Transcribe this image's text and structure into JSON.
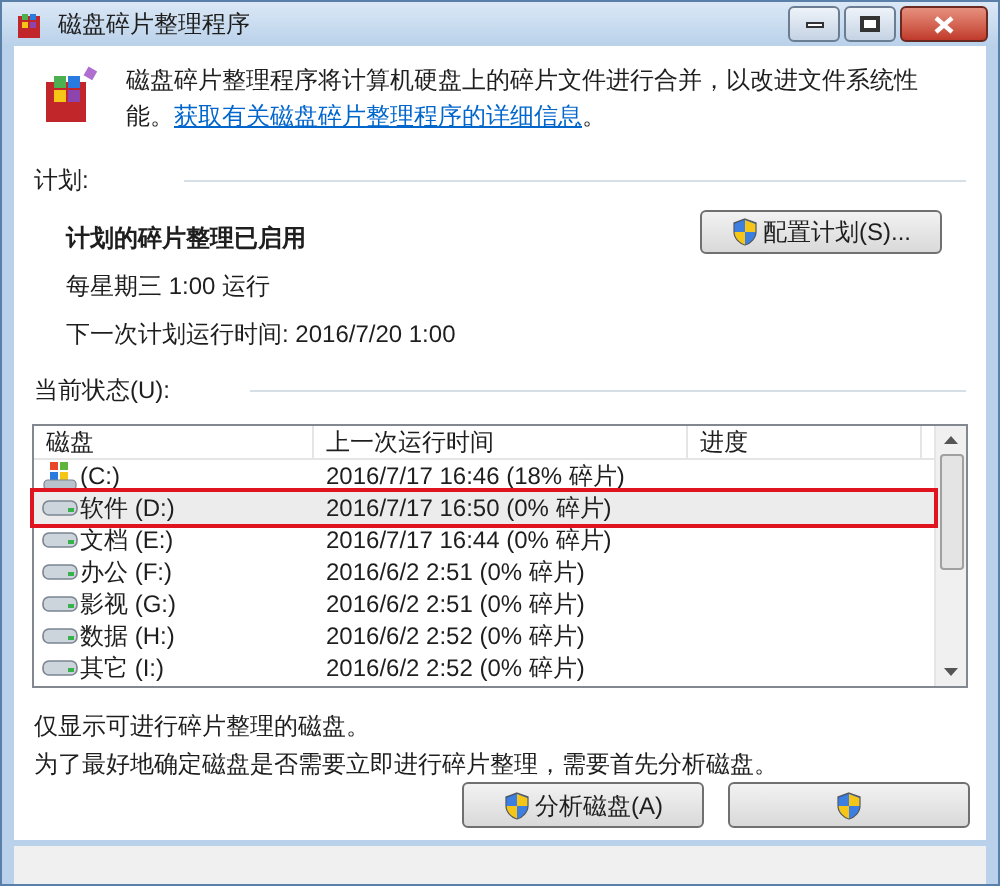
{
  "window": {
    "title": "磁盘碎片整理程序"
  },
  "intro": {
    "text": "磁盘碎片整理程序将计算机硬盘上的碎片文件进行合并，以改进文件系统性能。",
    "link": "获取有关磁盘碎片整理程序的详细信息",
    "tail": "。"
  },
  "schedule": {
    "label": "计划:",
    "status": "计划的碎片整理已启用",
    "frequency": "每星期三  1:00 运行",
    "next_run": "下一次计划运行时间: 2016/7/20 1:00",
    "button": "配置计划(S)..."
  },
  "current_status": {
    "label": "当前状态(U):",
    "columns": [
      "磁盘",
      "上一次运行时间",
      "进度"
    ],
    "rows": [
      {
        "kind": "system",
        "disk": "(C:)",
        "last_run": "2016/7/17 16:46 (18% 碎片)",
        "selected": false,
        "highlighted": false
      },
      {
        "kind": "drive",
        "disk": "软件 (D:)",
        "last_run": "2016/7/17 16:50 (0% 碎片)",
        "selected": true,
        "highlighted": true
      },
      {
        "kind": "drive",
        "disk": "文档 (E:)",
        "last_run": "2016/7/17 16:44 (0% 碎片)",
        "selected": false,
        "highlighted": false
      },
      {
        "kind": "drive",
        "disk": "办公 (F:)",
        "last_run": "2016/6/2 2:51 (0% 碎片)",
        "selected": false,
        "highlighted": false
      },
      {
        "kind": "drive",
        "disk": "影视 (G:)",
        "last_run": "2016/6/2 2:51 (0% 碎片)",
        "selected": false,
        "highlighted": false
      },
      {
        "kind": "drive",
        "disk": "数据 (H:)",
        "last_run": "2016/6/2 2:52 (0% 碎片)",
        "selected": false,
        "highlighted": false
      },
      {
        "kind": "drive",
        "disk": "其它 (I:)",
        "last_run": "2016/6/2 2:52 (0% 碎片)",
        "selected": false,
        "highlighted": false
      }
    ]
  },
  "notes": [
    "仅显示可进行碎片整理的磁盘。",
    "为了最好地确定磁盘是否需要立即进行碎片整理，需要首先分析磁盘。"
  ],
  "buttons": [
    {
      "label": "分析磁盘(A)"
    }
  ]
}
